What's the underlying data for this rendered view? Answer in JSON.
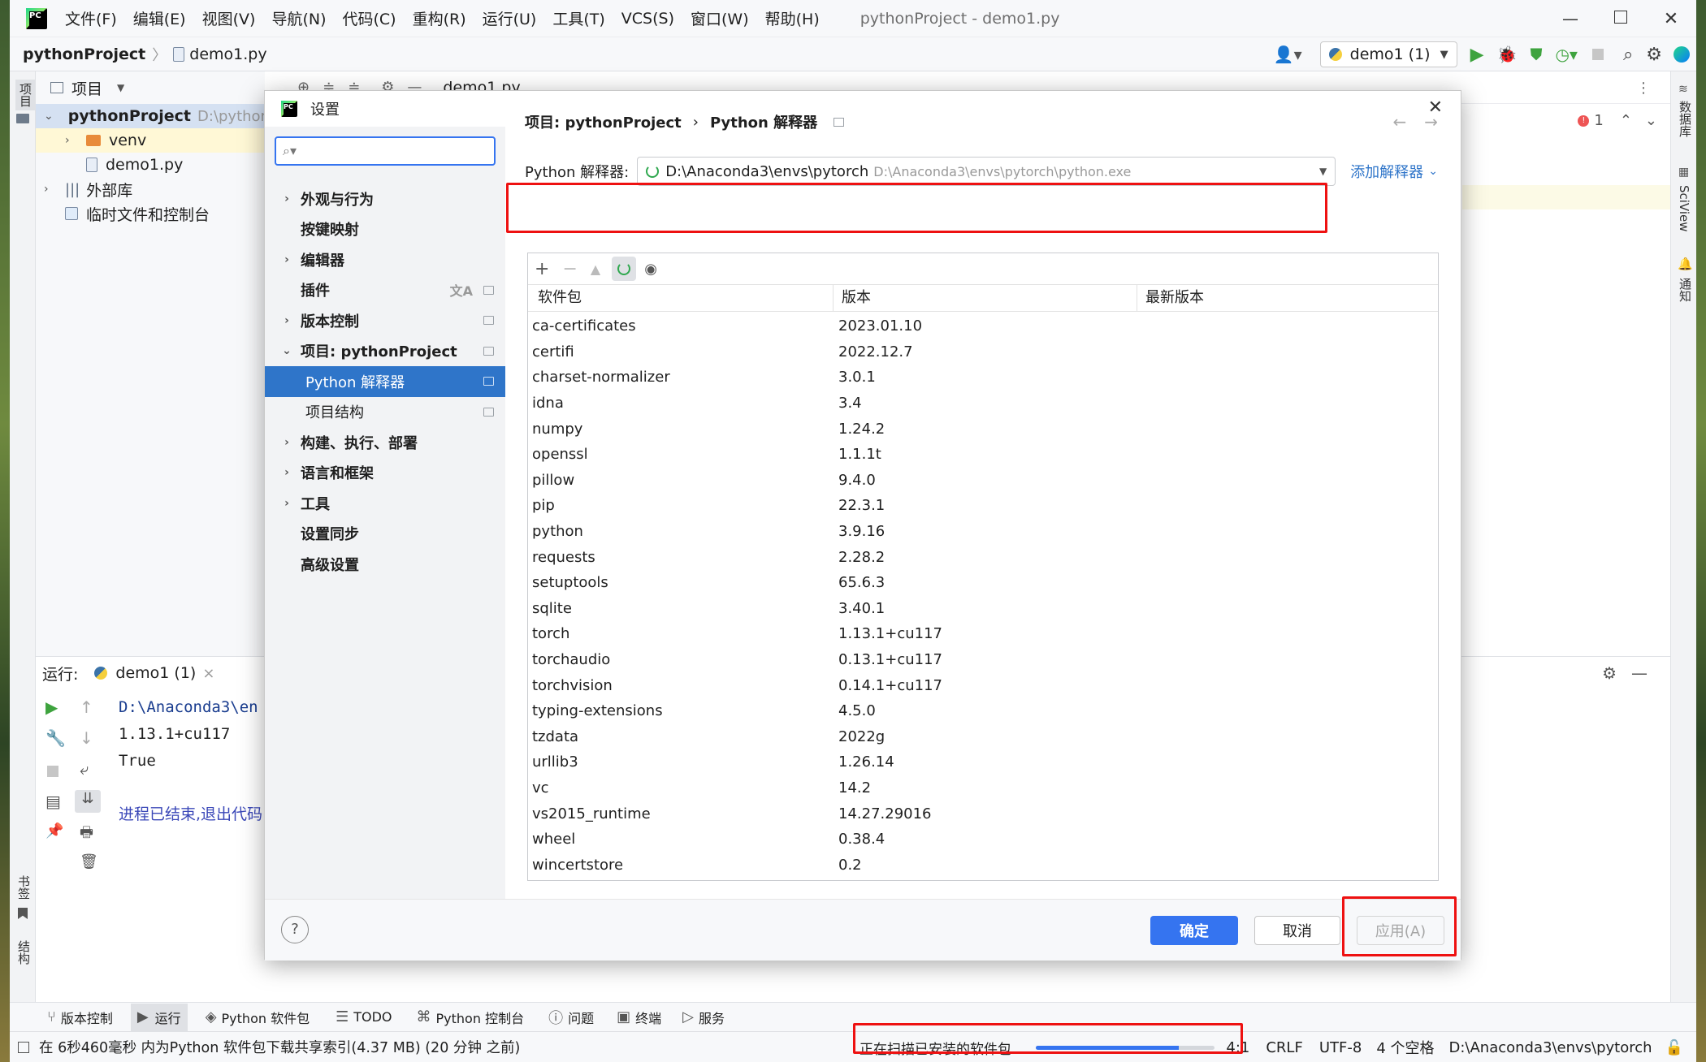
{
  "window": {
    "menu": [
      "文件(F)",
      "编辑(E)",
      "视图(V)",
      "导航(N)",
      "代码(C)",
      "重构(R)",
      "运行(U)",
      "工具(T)",
      "VCS(S)",
      "窗口(W)",
      "帮助(H)"
    ],
    "title": "pythonProject - demo1.py"
  },
  "navbar": {
    "project": "pythonProject",
    "file": "demo1.py",
    "run_config": "demo1 (1)"
  },
  "left_strip": {
    "project": "项目",
    "bookmarks": "书签",
    "structure": "结构"
  },
  "right_strip": {
    "database": "数据库",
    "sciview": "SciView",
    "notifications": "通知"
  },
  "project_panel": {
    "header": "项目",
    "tree": [
      {
        "label": "pythonProject",
        "hint": "D:\\python"
      },
      {
        "label": "venv"
      },
      {
        "label": "demo1.py"
      },
      {
        "label": "外部库"
      },
      {
        "label": "临时文件和控制台"
      }
    ]
  },
  "editor": {
    "tab": "demo1.py",
    "error_count": "1"
  },
  "run_panel": {
    "label": "运行:",
    "tab": "demo1 (1)",
    "lines": [
      "D:\\Anaconda3\\en",
      "1.13.1+cu117",
      "True",
      "",
      "进程已结束,退出代码"
    ]
  },
  "bottom_tabs": [
    "版本控制",
    "运行",
    "Python 软件包",
    "TODO",
    "Python 控制台",
    "问题",
    "终端",
    "服务"
  ],
  "statusbar": {
    "message": "在 6秒460毫秒 内为Python 软件包下载共享索引(4.37 MB) (20 分钟 之前)",
    "progress_text": "正在扫描已安装的软件包...",
    "progress": 0.8,
    "position": "4:1",
    "line_sep": "CRLF",
    "encoding": "UTF-8",
    "indent": "4 个空格",
    "interpreter": "D:\\Anaconda3\\envs\\pytorch"
  },
  "dialog": {
    "title": "设置",
    "search_placeholder": "",
    "nav": [
      {
        "label": "外观与行为",
        "chevron": true,
        "sub": false
      },
      {
        "label": "按键映射",
        "chevron": false,
        "sub": false
      },
      {
        "label": "编辑器",
        "chevron": true,
        "sub": false
      },
      {
        "label": "插件",
        "chevron": false,
        "sub": false
      },
      {
        "label": "版本控制",
        "chevron": true,
        "sub": false
      },
      {
        "label": "项目: pythonProject",
        "chevron": "open",
        "sub": false
      },
      {
        "label": "Python 解释器",
        "chevron": false,
        "sub": true,
        "selected": true
      },
      {
        "label": "项目结构",
        "chevron": false,
        "sub": true
      },
      {
        "label": "构建、执行、部署",
        "chevron": true,
        "sub": false
      },
      {
        "label": "语言和框架",
        "chevron": true,
        "sub": false
      },
      {
        "label": "工具",
        "chevron": true,
        "sub": false
      },
      {
        "label": "设置同步",
        "chevron": false,
        "sub": false
      },
      {
        "label": "高级设置",
        "chevron": false,
        "sub": false
      }
    ],
    "breadcrumb": {
      "project": "项目: pythonProject",
      "page": "Python 解释器"
    },
    "interpreter_label": "Python 解释器:",
    "interpreter_name": "D:\\Anaconda3\\envs\\pytorch",
    "interpreter_path": "D:\\Anaconda3\\envs\\pytorch\\python.exe",
    "add_interpreter": "添加解释器",
    "columns": [
      "软件包",
      "版本",
      "最新版本"
    ],
    "packages": [
      [
        "ca-certificates",
        "2023.01.10"
      ],
      [
        "certifi",
        "2022.12.7"
      ],
      [
        "charset-normalizer",
        "3.0.1"
      ],
      [
        "idna",
        "3.4"
      ],
      [
        "numpy",
        "1.24.2"
      ],
      [
        "openssl",
        "1.1.1t"
      ],
      [
        "pillow",
        "9.4.0"
      ],
      [
        "pip",
        "22.3.1"
      ],
      [
        "python",
        "3.9.16"
      ],
      [
        "requests",
        "2.28.2"
      ],
      [
        "setuptools",
        "65.6.3"
      ],
      [
        "sqlite",
        "3.40.1"
      ],
      [
        "torch",
        "1.13.1+cu117"
      ],
      [
        "torchaudio",
        "0.13.1+cu117"
      ],
      [
        "torchvision",
        "0.14.1+cu117"
      ],
      [
        "typing-extensions",
        "4.5.0"
      ],
      [
        "tzdata",
        "2022g"
      ],
      [
        "urllib3",
        "1.26.14"
      ],
      [
        "vc",
        "14.2"
      ],
      [
        "vs2015_runtime",
        "14.27.29016"
      ],
      [
        "wheel",
        "0.38.4"
      ],
      [
        "wincertstore",
        "0.2"
      ]
    ],
    "buttons": {
      "ok": "确定",
      "cancel": "取消",
      "apply": "应用(A)",
      "help": "?"
    }
  },
  "colors": {
    "accent": "#2f75c9",
    "highlight_border": "#ee1111",
    "run_green": "#3ea33e"
  }
}
